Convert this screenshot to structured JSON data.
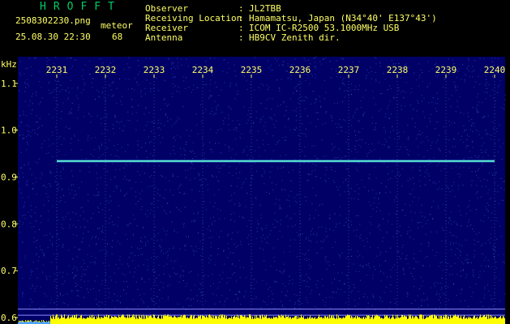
{
  "header": {
    "brand": "HROFFT",
    "filename": "2508302230.png",
    "datetime": "25.08.30 22:30",
    "type_label": "meteor",
    "meteor_count": "68"
  },
  "station": [
    {
      "label": "Observer",
      "value": "JL2TBB"
    },
    {
      "label": "Receiving Location",
      "value": "Hamamatsu, Japan (N34°40' E137°43')"
    },
    {
      "label": "Receiver",
      "value": "ICOM IC-R2500 53.1000MHz USB"
    },
    {
      "label": "Antenna",
      "value": "HB9CV Zenith dir."
    }
  ],
  "colors": {
    "background": "#000000",
    "text": "#ffff66",
    "brand": "#00cc66",
    "noise_floor": "#000066",
    "signal": "#66ffcc",
    "level_bars": "#ffff00"
  },
  "chart_data": {
    "type": "heatmap",
    "title": "",
    "xlabel": "",
    "ylabel": "kHz",
    "x_ticks": [
      "2231",
      "2232",
      "2233",
      "2234",
      "2235",
      "2236",
      "2237",
      "2238",
      "2239",
      "2240"
    ],
    "y_ticks": [
      "1.1",
      "1.0",
      "0.9",
      "0.8",
      "0.7",
      "0.6"
    ],
    "y_range_khz": [
      0.6,
      1.15
    ],
    "x_range_minutes": [
      2231,
      2240
    ],
    "carrier": {
      "freq_khz": 0.934,
      "start_min": 2231,
      "end_min": 2240
    },
    "reference_lines_khz": [
      0.618,
      0.605
    ]
  }
}
